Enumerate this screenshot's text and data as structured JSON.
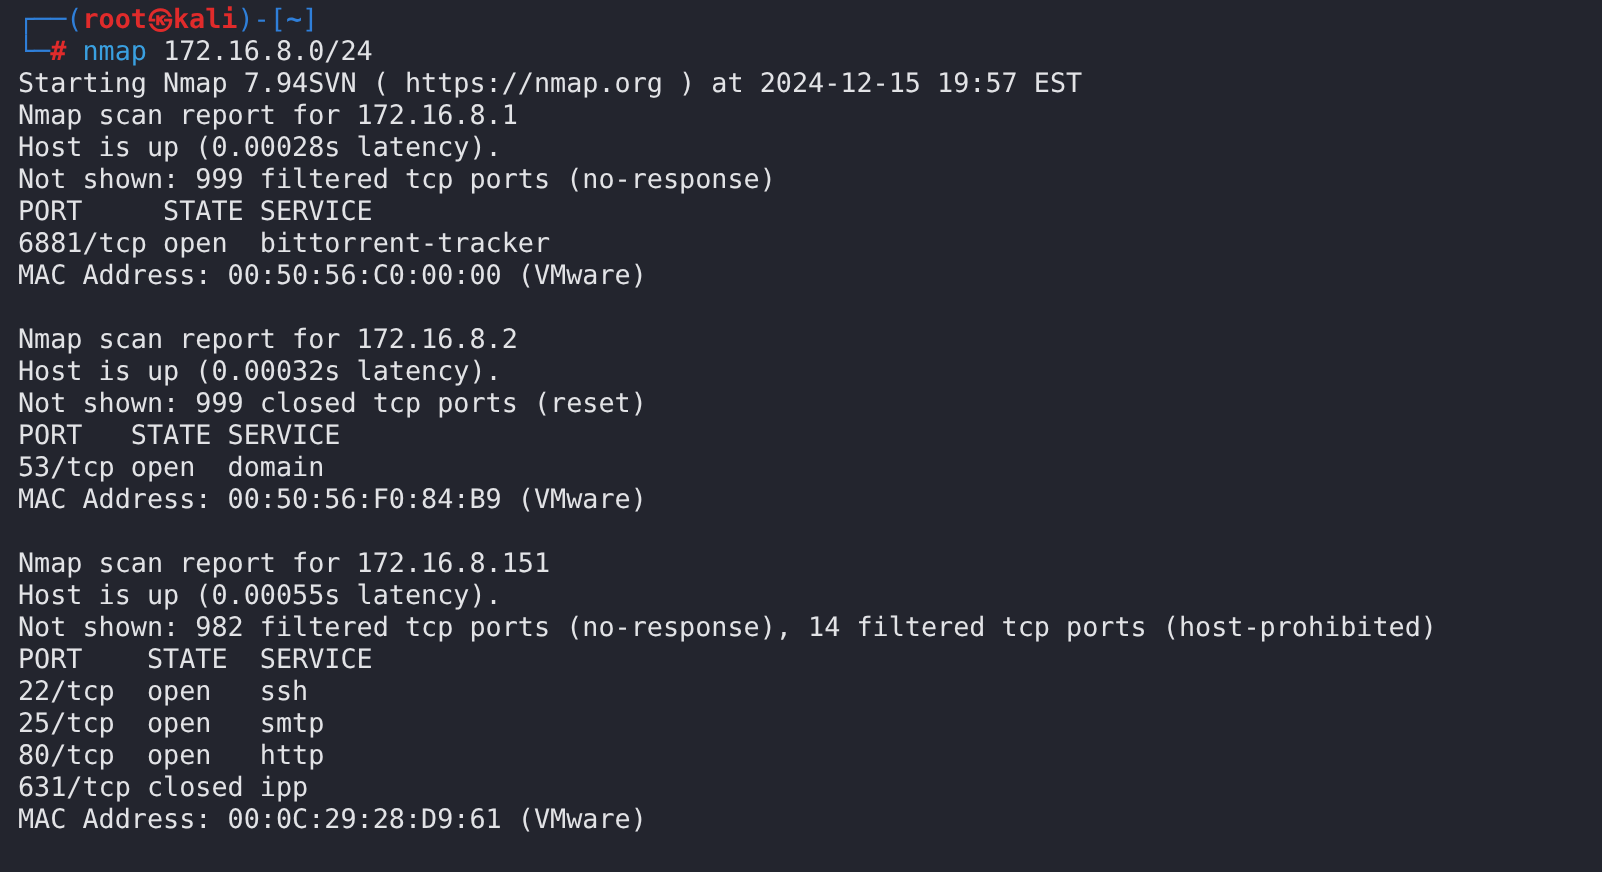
{
  "prompt": {
    "frame_top": "┌──(",
    "user": "root",
    "at": "㉿",
    "host": "kali",
    "mid": ")-[",
    "dir": "~",
    "close": "]",
    "frame_bottom": "└─",
    "symbol": "#",
    "command": "nmap",
    "argument": "172.16.8.0/24"
  },
  "start_line": "Starting Nmap 7.94SVN ( https://nmap.org ) at 2024-12-15 19:57 EST",
  "reports": [
    {
      "lines": [
        "Nmap scan report for 172.16.8.1",
        "Host is up (0.00028s latency).",
        "Not shown: 999 filtered tcp ports (no-response)",
        "PORT     STATE SERVICE",
        "6881/tcp open  bittorrent-tracker",
        "MAC Address: 00:50:56:C0:00:00 (VMware)"
      ]
    },
    {
      "lines": [
        "Nmap scan report for 172.16.8.2",
        "Host is up (0.00032s latency).",
        "Not shown: 999 closed tcp ports (reset)",
        "PORT   STATE SERVICE",
        "53/tcp open  domain",
        "MAC Address: 00:50:56:F0:84:B9 (VMware)"
      ]
    },
    {
      "lines": [
        "Nmap scan report for 172.16.8.151",
        "Host is up (0.00055s latency).",
        "Not shown: 982 filtered tcp ports (no-response), 14 filtered tcp ports (host-prohibited)",
        "PORT    STATE  SERVICE",
        "22/tcp  open   ssh",
        "25/tcp  open   smtp",
        "80/tcp  open   http",
        "631/tcp closed ipp",
        "MAC Address: 00:0C:29:28:D9:61 (VMware)"
      ]
    }
  ]
}
